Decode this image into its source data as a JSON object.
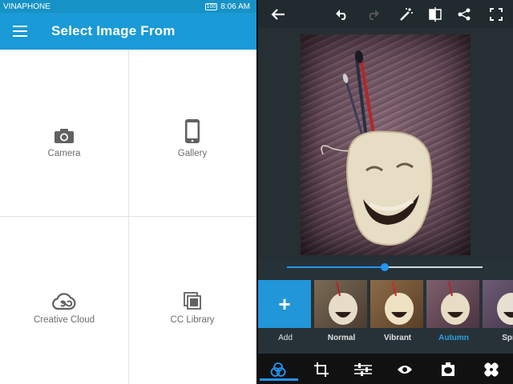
{
  "status_bar": {
    "carrier": "VINAPHONE",
    "battery": "100",
    "time": "8:06 AM"
  },
  "app_bar": {
    "title": "Select Image From"
  },
  "sources": [
    {
      "label": "Camera",
      "icon": "camera-icon"
    },
    {
      "label": "Gallery",
      "icon": "phone-icon"
    },
    {
      "label": "Creative Cloud",
      "icon": "creative-cloud-icon"
    },
    {
      "label": "CC Library",
      "icon": "library-icon"
    }
  ],
  "editor": {
    "toolbar_icons": [
      "back-arrow-icon",
      "undo-icon",
      "redo-icon",
      "magic-wand-icon",
      "compare-icon",
      "share-icon",
      "fullscreen-icon"
    ],
    "intensity_fraction": 0.5,
    "filters": [
      {
        "label": "Add",
        "active": false
      },
      {
        "label": "Normal",
        "active": false
      },
      {
        "label": "Vibrant",
        "active": false
      },
      {
        "label": "Autumn",
        "active": true
      },
      {
        "label": "Spri",
        "active": false
      }
    ],
    "bottom_tools": [
      "looks-icon",
      "crop-icon",
      "adjust-icon",
      "eye-icon",
      "vignette-icon",
      "healing-icon"
    ],
    "active_tool": "looks-icon"
  },
  "colors": {
    "accent": "#1a9ad6",
    "active_filter": "#2ea0e0",
    "editor_bg": "#263238"
  }
}
